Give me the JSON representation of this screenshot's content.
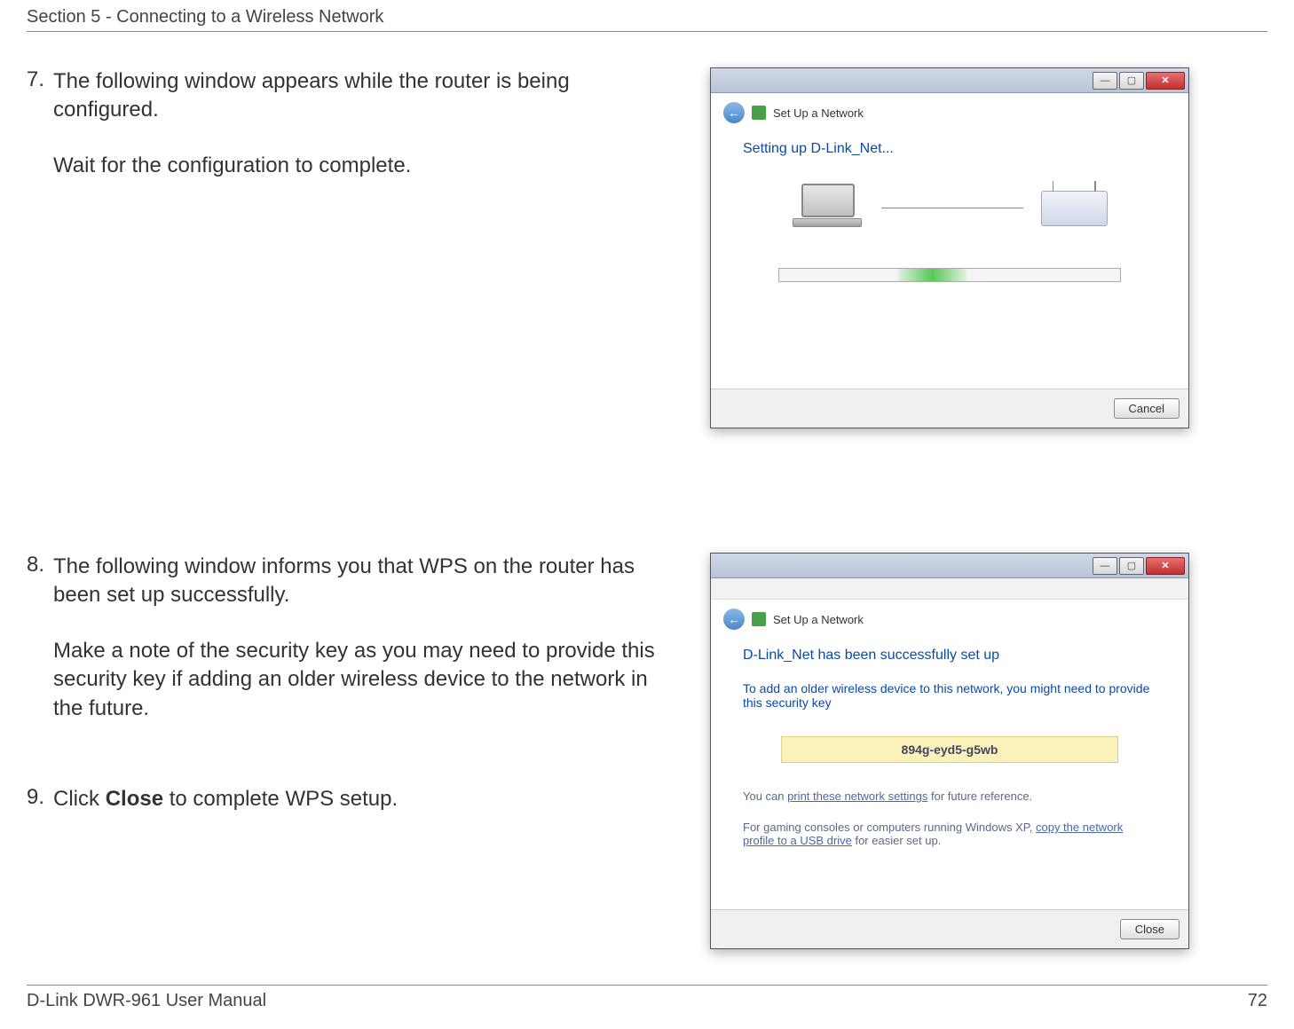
{
  "header": {
    "section_title": "Section 5 - Connecting to a Wireless Network"
  },
  "steps": {
    "s7": {
      "num": "7.",
      "line1": "The following window appears while the router is being configured.",
      "line2": "Wait for the configuration to complete."
    },
    "s8": {
      "num": "8.",
      "line1": "The following window informs you that WPS on the router has been set up successfully.",
      "line2": "Make a note of the security key as you may need to provide this security key if adding an older wireless device to the network in the future."
    },
    "s9": {
      "num": "9.",
      "pre": "Click ",
      "bold": "Close",
      "post": " to complete WPS setup."
    }
  },
  "dialog1": {
    "nav_label": "Set Up a Network",
    "heading": "Setting up D-Link_Net...",
    "footer_btn": "Cancel"
  },
  "dialog2": {
    "nav_label": "Set Up a Network",
    "heading": "D-Link_Net has been successfully set up",
    "msg": "To add an older wireless device to this network, you might need to provide this security key",
    "key": "894g-eyd5-g5wb",
    "note1_pre": "You can ",
    "note1_link": "print these network settings",
    "note1_post": " for future reference.",
    "note2_pre": "For gaming consoles or computers running Windows XP, ",
    "note2_link": "copy the network profile to a USB drive",
    "note2_post": " for easier set up.",
    "footer_btn": "Close"
  },
  "footer": {
    "manual": "D-Link DWR-961 User Manual",
    "page": "72"
  }
}
